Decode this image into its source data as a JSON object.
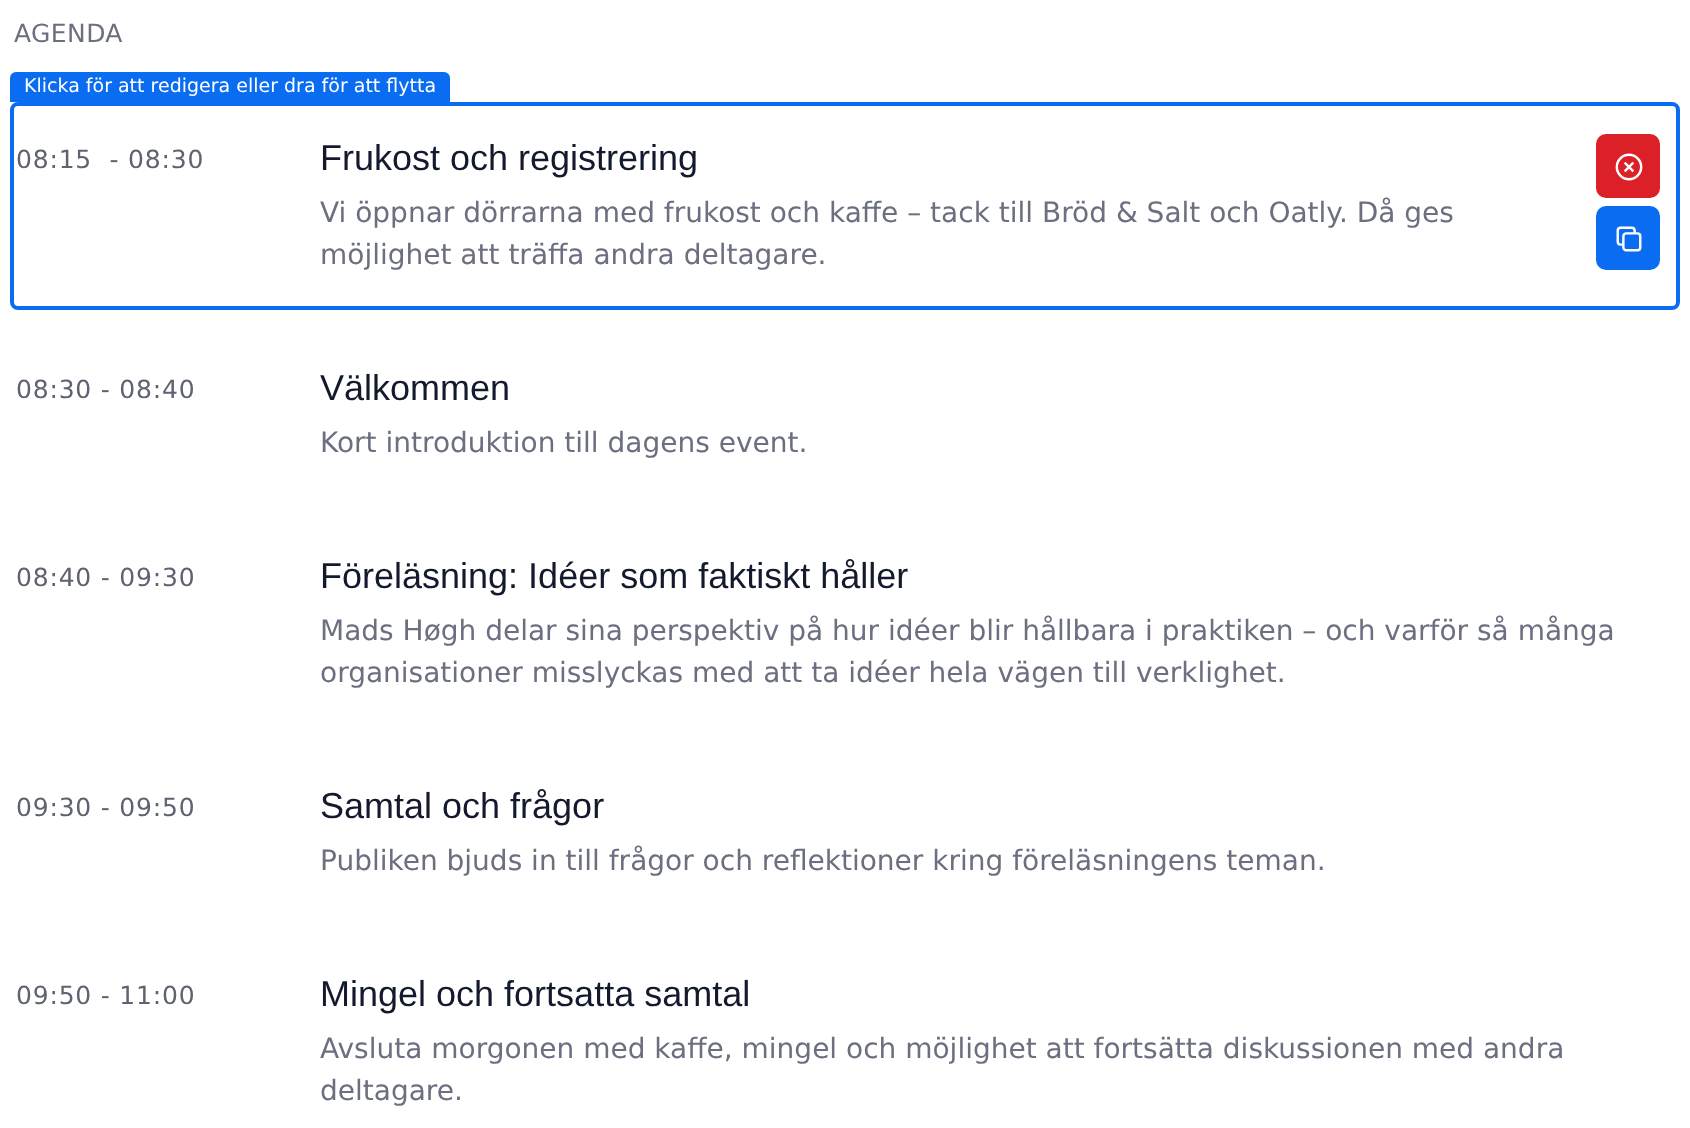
{
  "heading": "AGENDA",
  "edit_hint": "Klicka för att redigera eller dra för att flytta",
  "items": [
    {
      "time": "08:15  - 08:30",
      "title": "Frukost och registrering",
      "description": "Vi öppnar dörrarna med frukost och kaffe – tack till Bröd & Salt och Oatly. Då ges möjlighet att träffa andra deltagare.",
      "selected": true
    },
    {
      "time": "08:30 - 08:40",
      "title": "Välkommen",
      "description": "Kort introduktion till dagens event.",
      "selected": false
    },
    {
      "time": "08:40 - 09:30",
      "title": "Föreläsning: Idéer som faktiskt håller",
      "description": "Mads Høgh delar sina perspektiv på hur idéer blir hållbara i praktiken – och varför så många organisationer misslyckas med att ta idéer hela vägen till verklighet.",
      "selected": false
    },
    {
      "time": "09:30 - 09:50",
      "title": "Samtal och frågor",
      "description": "Publiken bjuds in till frågor och reflektioner kring föreläsningens teman.",
      "selected": false
    },
    {
      "time": "09:50 - 11:00",
      "title": "Mingel och fortsatta samtal",
      "description": "Avsluta morgonen med kaffe, mingel och möjlighet att fortsätta diskussionen med andra deltagare.",
      "selected": false
    }
  ]
}
